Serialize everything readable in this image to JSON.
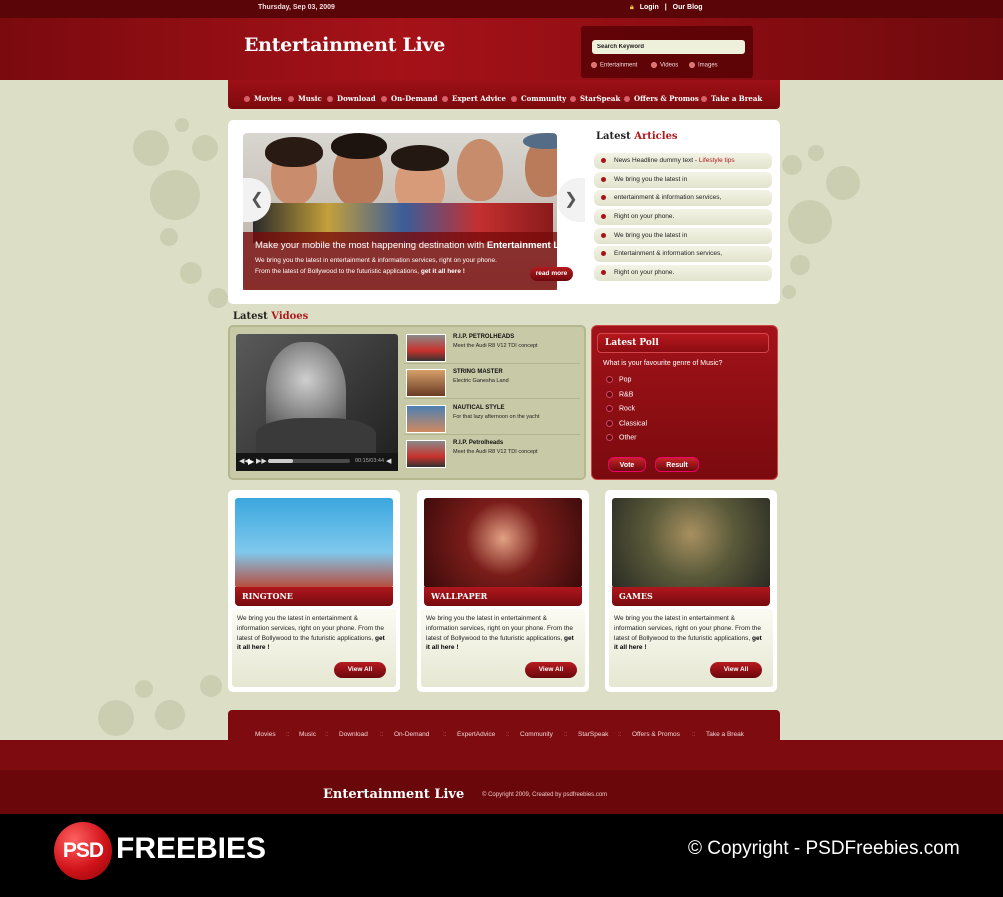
{
  "header": {
    "date": "Thursday, Sep 03, 2009",
    "login": "Login",
    "separator": "|",
    "blog": "Our Blog",
    "logo": "Entertainment Live",
    "search_placeholder": "Search Keyword",
    "search_options": [
      "Entertainment",
      "Videos",
      "Images"
    ]
  },
  "nav": [
    "Movies",
    "Music",
    "Download",
    "On-Demand",
    "Expert Advice",
    "Community",
    "StarSpeak",
    "Offers & Promos",
    "Take a Break"
  ],
  "hero": {
    "title_pre": "Make your mobile the most happening destination with ",
    "title_bold": "Entertainment Live!",
    "line1": "We bring you the latest in entertainment & information services, right on your phone.",
    "line2_pre": "From the latest of  Bollywood to the futuristic applications,  ",
    "line2_bold": "get it all here !",
    "read_more": "read more"
  },
  "articles": {
    "title_a": "Latest ",
    "title_b": "Articles",
    "items": [
      {
        "text": "News Headline dummy text - ",
        "tag": "Lifestyle tips"
      },
      {
        "text": "We bring you the latest in",
        "tag": ""
      },
      {
        "text": "entertainment & information services,",
        "tag": ""
      },
      {
        "text": "Right on your phone.",
        "tag": ""
      },
      {
        "text": "We bring you the latest in",
        "tag": ""
      },
      {
        "text": "Entertainment & information services,",
        "tag": ""
      },
      {
        "text": "Right on your phone.",
        "tag": ""
      }
    ]
  },
  "videos": {
    "title_a": "Latest ",
    "title_b": "Vidoes",
    "time": "00:15/03:44",
    "progress": 0.3,
    "items": [
      {
        "title": "R.I.P. PETROLHEADS",
        "desc": "Meet the Audi R8 V12 TDI concept"
      },
      {
        "title": "STRING MASTER",
        "desc": "Electric Ganesha Land"
      },
      {
        "title": "NAUTICAL STYLE",
        "desc": "For that lazy afternoon on the yacht"
      },
      {
        "title": "R.I.P. Petrolheads",
        "desc": "Meet the Audi R8 V12 TDI concept"
      }
    ]
  },
  "poll": {
    "title": "Latest Poll",
    "question": "What is your favourite genre of Music?",
    "options": [
      "Pop",
      "R&B",
      "Rock",
      "Classical",
      "Other"
    ],
    "vote": "Vote",
    "result": "Result"
  },
  "cards": [
    {
      "title": "RINGTONE",
      "text": "We bring you the latest in entertainment & information services, right on your phone. From the latest of Bollywood to the futuristic applications, ",
      "bold": "get it all here !",
      "button": "View All"
    },
    {
      "title": "WALLPAPER",
      "text": "We bring you the latest in entertainment & information services, right on your phone. From the latest of Bollywood to the futuristic applications, ",
      "bold": "get it all here !",
      "button": "View All"
    },
    {
      "title": "GAMES",
      "text": "We bring you the latest in entertainment & information services, right on your phone. From the latest of Bollywood to the futuristic applications, ",
      "bold": "get it all here !",
      "button": "View All"
    }
  ],
  "footer": {
    "nav": [
      "Movies",
      "Music",
      "Download",
      "On-Demand",
      "ExpertAdvice",
      "Community",
      "StarSpeak",
      "Offers & Promos",
      "Take a Break"
    ],
    "sep": "::",
    "logo": "Entertainment Live",
    "copy": "© Copyright 2009, Created by psdfreebies.com"
  },
  "watermark": {
    "psd": "PSD",
    "freebies": "FREEBIES",
    "copyright": "© Copyright - PSDFreebies.com"
  },
  "colors": {
    "brand_red": "#8b0d12",
    "background": "#dcdfc6"
  }
}
